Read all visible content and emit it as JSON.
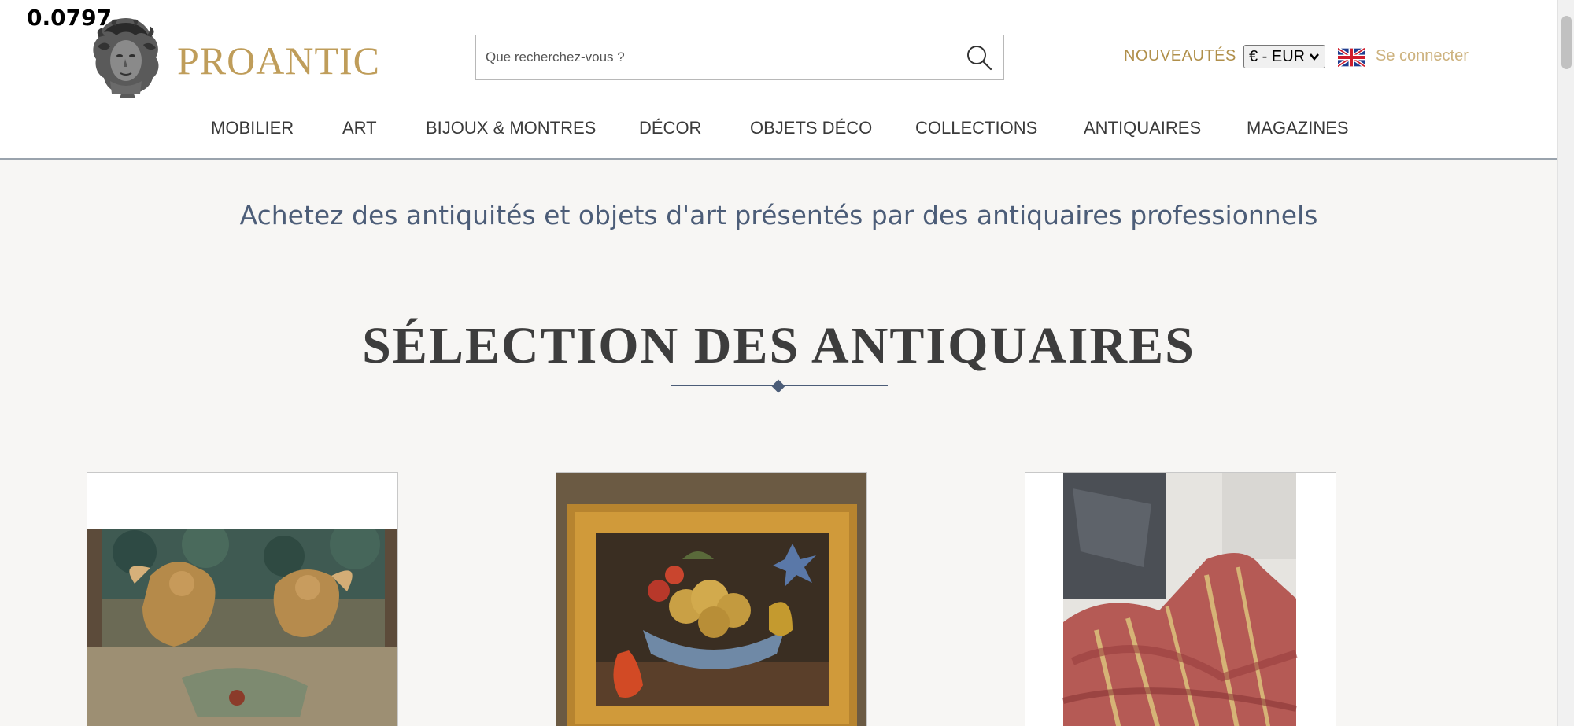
{
  "overlay_value": "0.0797",
  "header": {
    "logo_text": "PROANTIC",
    "search_placeholder": "Que recherchez-vous ?",
    "nouveautes_label": "NOUVEAUTÉS",
    "currency_selected": "€ - EUR",
    "language_flag": "uk-flag-icon",
    "login_label": "Se connecter",
    "accent_color": "#bf9d5a"
  },
  "nav": {
    "items": [
      {
        "label": "MOBILIER"
      },
      {
        "label": "ART"
      },
      {
        "label": "BIJOUX & MONTRES"
      },
      {
        "label": "DÉCOR"
      },
      {
        "label": "OBJETS DÉCO"
      },
      {
        "label": "COLLECTIONS"
      },
      {
        "label": "ANTIQUAIRES"
      },
      {
        "label": "MAGAZINES"
      }
    ]
  },
  "main": {
    "tagline": "Achetez des antiquités et objets d'art présentés par des antiquaires professionnels",
    "section_title": "SÉLECTION DES ANTIQUAIRES",
    "cards": [
      {
        "image": "tapestry-with-gilded-cherubs"
      },
      {
        "image": "still-life-fruit-bowl-gilt-frame"
      },
      {
        "image": "striped-red-silk-fabric"
      }
    ]
  }
}
